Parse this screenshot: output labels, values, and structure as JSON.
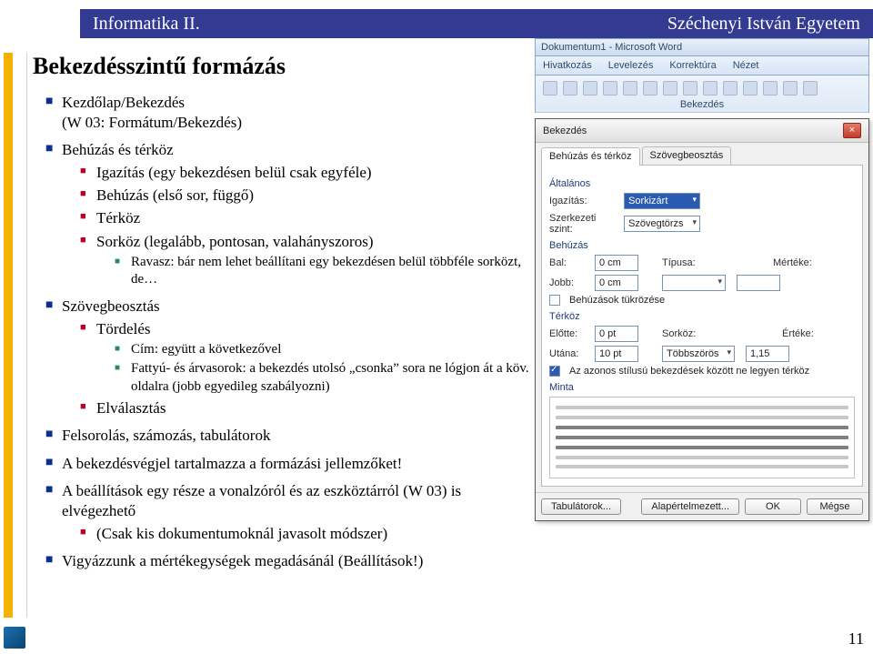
{
  "header": {
    "course": "Informatika II.",
    "university": "Széchenyi István Egyetem"
  },
  "title": "Bekezdésszintű formázás",
  "bullets": {
    "b1": "Kezdőlap/Bekezdés",
    "b1sub": "(W 03: Formátum/Bekezdés)",
    "b2": "Behúzás és térköz",
    "b2_1": "Igazítás (egy bekezdésen belül csak egyféle)",
    "b2_2": "Behúzás (első sor, függő)",
    "b2_3": "Térköz",
    "b2_4": "Sorköz (legalább, pontosan, valahányszoros)",
    "b2_4_1": "Ravasz: bár nem lehet beállítani egy bekezdésen belül többféle sorközt, de…",
    "b3": "Szövegbeosztás",
    "b3_1": "Tördelés",
    "b3_1_1": "Cím: együtt a következővel",
    "b3_1_2": "Fattyú- és árvasorok: a bekezdés utolsó „csonka” sora ne lógjon át a köv. oldalra (jobb egyedileg szabályozni)",
    "b3_2": "Elválasztás",
    "b4": "Felsorolás, számozás, tabulátorok",
    "b5": "A bekezdésvégjel tartalmazza a formázási jellemzőket!",
    "b6": "A beállítások egy része a vonalzóról és az eszköztárról (W 03) is elvégezhető",
    "b6_1": "(Csak kis dokumentumoknál javasolt módszer)",
    "b7": "Vigyázzunk a mértékegységek megadásánál (Beállítások!)"
  },
  "word": {
    "title": "Dokumentum1 - Microsoft Word",
    "tabs": [
      "Hivatkozás",
      "Levelezés",
      "Korrektúra",
      "Nézet"
    ],
    "ribbon_group": "Bekezdés",
    "dialog_title": "Bekezdés",
    "dlg_tab1": "Behúzás és térköz",
    "dlg_tab2": "Szövegbeosztás",
    "sect_general": "Általános",
    "lbl_align": "Igazítás:",
    "val_align": "Sorkizárt",
    "lbl_level": "Szerkezeti szint:",
    "val_level": "Szövegtörzs",
    "sect_indent": "Behúzás",
    "lbl_left": "Bal:",
    "val_left": "0 cm",
    "lbl_right": "Jobb:",
    "val_right": "0 cm",
    "lbl_type": "Típusa:",
    "lbl_measure": "Mértéke:",
    "chk_mirror": "Behúzások tükrözése",
    "sect_space": "Térköz",
    "lbl_before": "Előtte:",
    "val_before": "0 pt",
    "lbl_after": "Utána:",
    "val_after": "10 pt",
    "lbl_linesp": "Sorköz:",
    "val_linesp": "Többszörös",
    "lbl_value": "Értéke:",
    "val_value": "1,15",
    "chk_nospace": "Az azonos stílusú bekezdések között ne legyen térköz",
    "sect_preview": "Minta",
    "btn_tabs": "Tabulátorok...",
    "btn_default": "Alapértelmezett...",
    "btn_ok": "OK",
    "btn_cancel": "Mégse"
  },
  "page_number": "11"
}
